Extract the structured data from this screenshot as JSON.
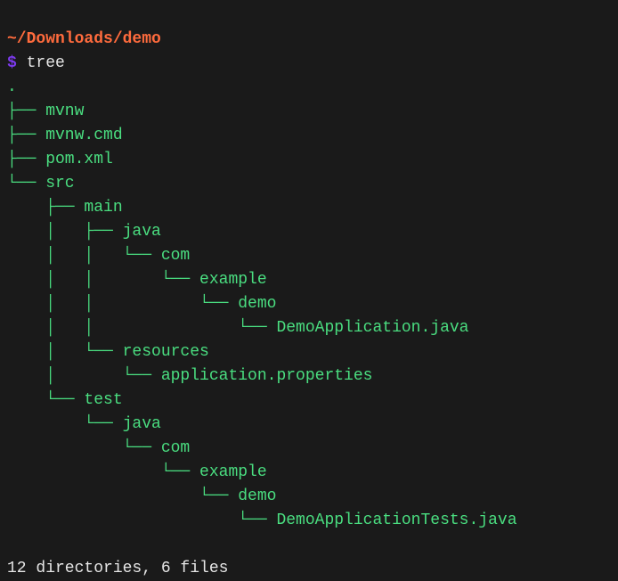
{
  "prompt": {
    "cwd": "~/Downloads/demo",
    "symbol": "$",
    "command": "tree"
  },
  "tree": {
    "lines": [
      ".",
      "├── mvnw",
      "├── mvnw.cmd",
      "├── pom.xml",
      "└── src",
      "    ├── main",
      "    │   ├── java",
      "    │   │   └── com",
      "    │   │       └── example",
      "    │   │           └── demo",
      "    │   │               └── DemoApplication.java",
      "    │   └── resources",
      "    │       └── application.properties",
      "    └── test",
      "        └── java",
      "            └── com",
      "                └── example",
      "                    └── demo",
      "                        └── DemoApplicationTests.java"
    ]
  },
  "summary": "12 directories, 6 files"
}
